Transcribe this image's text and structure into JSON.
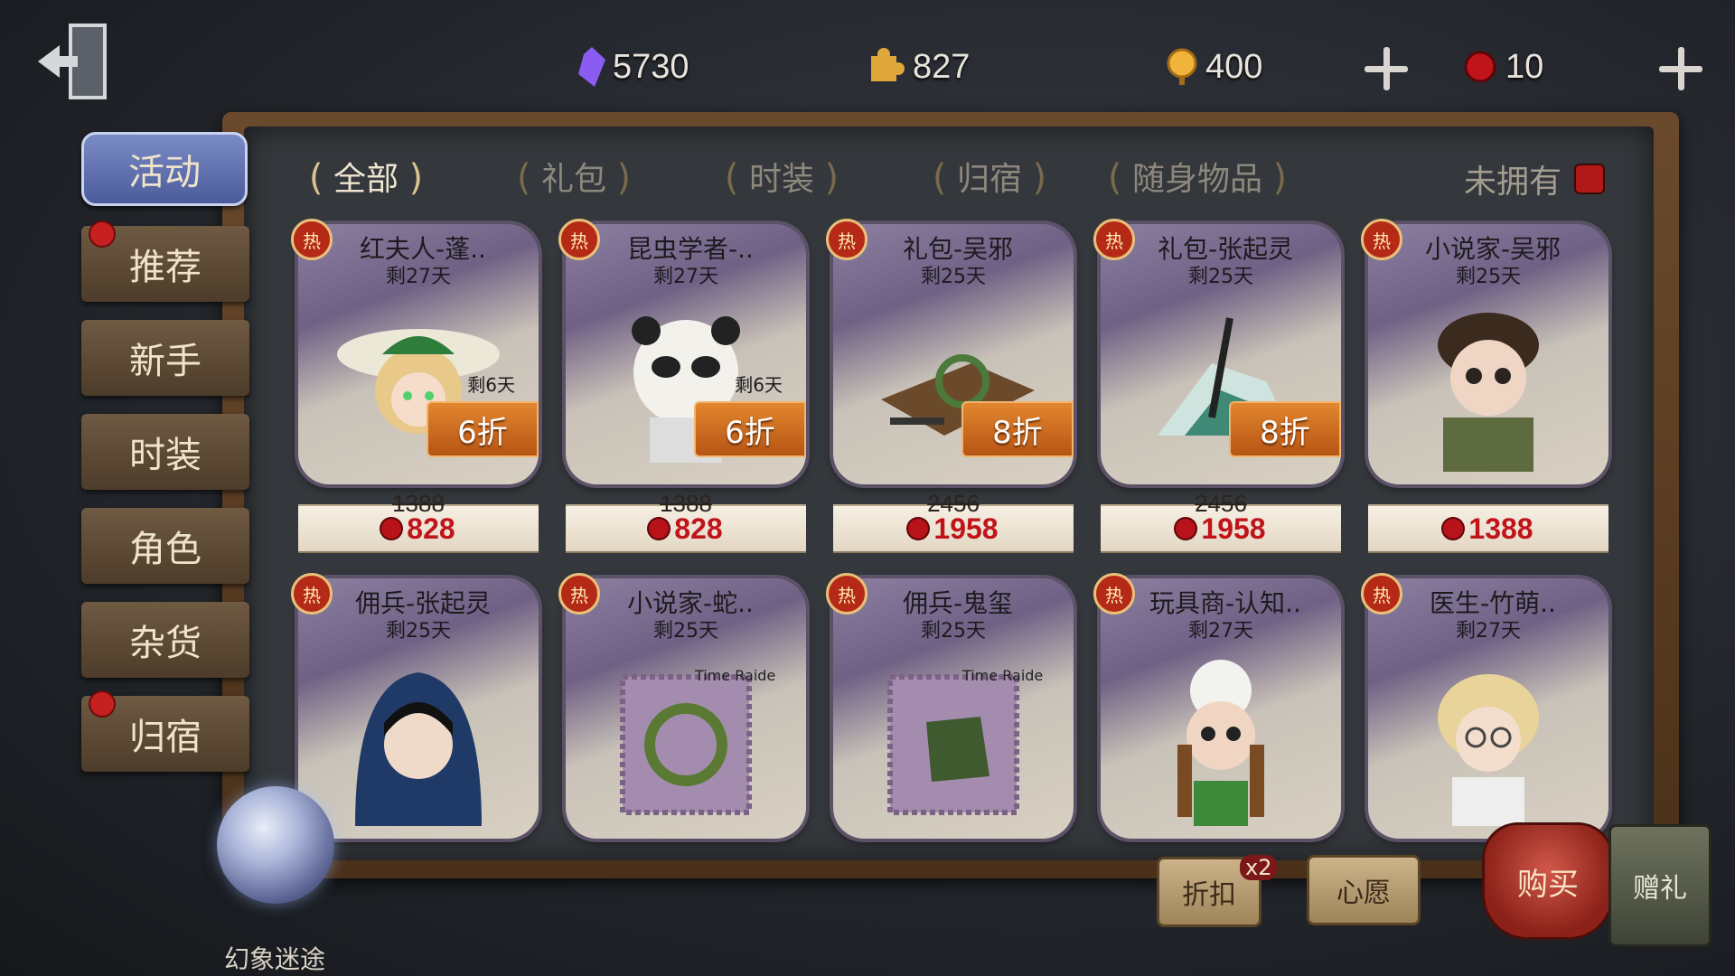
{
  "currencies": [
    {
      "icon": "purple-crystal-icon",
      "amount": "5730",
      "color": "#8a5cf2"
    },
    {
      "icon": "puzzle-piece-icon",
      "amount": "827",
      "color": "#e0a83a"
    },
    {
      "icon": "gold-coin-icon",
      "amount": "400",
      "color": "#f0b43a"
    },
    {
      "icon": "red-seal-icon",
      "amount": "10",
      "color": "#c0141b"
    }
  ],
  "tabs": [
    "全部",
    "礼包",
    "时装",
    "归宿",
    "随身物品"
  ],
  "active_tab": "全部",
  "filter": {
    "label": "未拥有",
    "checked": true
  },
  "sidenav": [
    {
      "label": "活动",
      "active": true,
      "badge": false
    },
    {
      "label": "推荐",
      "active": false,
      "badge": true
    },
    {
      "label": "新手",
      "active": false,
      "badge": false
    },
    {
      "label": "时装",
      "active": false,
      "badge": false
    },
    {
      "label": "角色",
      "active": false,
      "badge": false
    },
    {
      "label": "杂货",
      "active": false,
      "badge": false
    },
    {
      "label": "归宿",
      "active": false,
      "badge": true
    }
  ],
  "hot_label": "热",
  "items": [
    {
      "title": "红夫人-蓬..",
      "days": "剩27天",
      "sub_days": "剩6天",
      "discount": "6折",
      "original": "1388",
      "price": "828",
      "art": "lady-portrait"
    },
    {
      "title": "昆虫学者-..",
      "days": "剩27天",
      "sub_days": "剩6天",
      "discount": "6折",
      "original": "1388",
      "price": "828",
      "art": "panda-hood-portrait"
    },
    {
      "title": "礼包-吴邪",
      "days": "剩25天",
      "sub_days": "",
      "discount": "8折",
      "original": "2456",
      "price": "1958",
      "art": "book-bundle"
    },
    {
      "title": "礼包-张起灵",
      "days": "剩25天",
      "sub_days": "",
      "discount": "8折",
      "original": "2456",
      "price": "1958",
      "art": "sword-bundle"
    },
    {
      "title": "小说家-吴邪",
      "days": "剩25天",
      "sub_days": "",
      "discount": "",
      "original": "",
      "price": "1388",
      "art": "man-portrait"
    },
    {
      "title": "佣兵-张起灵",
      "days": "剩25天",
      "art": "hooded-portrait"
    },
    {
      "title": "小说家-蛇..",
      "days": "剩25天",
      "art": "snake-ring-stamp"
    },
    {
      "title": "佣兵-鬼玺",
      "days": "剩25天",
      "art": "jade-seal-stamp"
    },
    {
      "title": "玩具商-认知..",
      "days": "剩27天",
      "art": "girl-portrait"
    },
    {
      "title": "医生-竹萌..",
      "days": "剩27天",
      "art": "blonde-portrait"
    }
  ],
  "stamp_text": "Time Raiders",
  "bottom": {
    "orb_label": "幻象迷途",
    "coupon_label": "折扣",
    "coupon_mult": "x2",
    "wish_label": "心愿",
    "buy_label": "购买",
    "gift_label": "赠礼"
  }
}
